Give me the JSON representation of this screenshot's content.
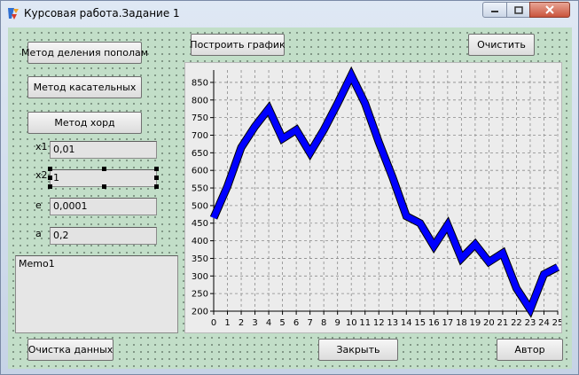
{
  "window": {
    "title": "Курсовая работа.Задание 1"
  },
  "buttons": {
    "bisection": "Метод деления пополам",
    "tangent": "Метод касательных",
    "chord": "Метод хорд",
    "build_graph": "Построить график",
    "clear": "Очистить",
    "clear_data": "Очистка данных",
    "close": "Закрыть",
    "author": "Автор"
  },
  "fields": {
    "x1": {
      "label": "x1",
      "value": "0,01"
    },
    "x2": {
      "label": "x2",
      "value": "1"
    },
    "e": {
      "label": "e",
      "value": "0,0001"
    },
    "a": {
      "label": "a",
      "value": "0,2"
    }
  },
  "memo": {
    "text": "Memo1"
  },
  "chart_data": {
    "type": "line",
    "x": [
      0,
      1,
      2,
      3,
      4,
      5,
      6,
      7,
      8,
      9,
      10,
      11,
      12,
      13,
      14,
      15,
      16,
      17,
      18,
      19,
      20,
      21,
      22,
      23,
      24,
      25
    ],
    "series": [
      {
        "values": [
          465,
          555,
          665,
          725,
          775,
          690,
          715,
          650,
          715,
          790,
          870,
          790,
          680,
          580,
          470,
          450,
          385,
          445,
          350,
          390,
          340,
          365,
          265,
          205,
          305,
          325
        ]
      }
    ],
    "ylim": [
      200,
      870
    ],
    "yticks": [
      200,
      250,
      300,
      350,
      400,
      450,
      500,
      550,
      600,
      650,
      700,
      750,
      800,
      850
    ],
    "xticks": [
      0,
      1,
      2,
      3,
      4,
      5,
      6,
      7,
      8,
      9,
      10,
      11,
      12,
      13,
      14,
      15,
      16,
      17,
      18,
      19,
      20,
      21,
      22,
      23,
      24,
      25
    ],
    "grid": true,
    "colors": {
      "series": "#0000ff",
      "outline": "#000000"
    }
  }
}
